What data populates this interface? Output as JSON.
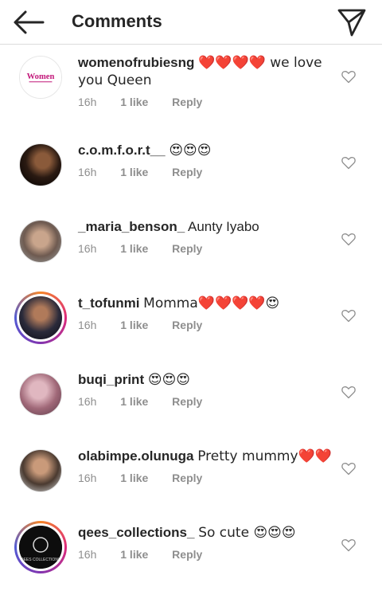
{
  "header": {
    "title": "Comments",
    "back_icon": "arrow-left-icon",
    "send_icon": "paper-plane-icon"
  },
  "comments": [
    {
      "username": "womenofrubiesng",
      "text": "❤️❤️❤️❤️ we love you Queen",
      "time": "16h",
      "likes": "1 like",
      "reply": "Reply",
      "avatar_text": "Women"
    },
    {
      "username": "c.o.m.f.o.r.t__",
      "text": "😍😍😍",
      "time": "16h",
      "likes": "1 like",
      "reply": "Reply"
    },
    {
      "username": "_maria_benson_",
      "text": "Aunty Iyabo",
      "time": "16h",
      "likes": "1 like",
      "reply": "Reply"
    },
    {
      "username": "t_tofunmi",
      "text": "Momma❤️❤️❤️❤️😍",
      "time": "16h",
      "likes": "1 like",
      "reply": "Reply"
    },
    {
      "username": "buqi_print",
      "text": "😍😍😍",
      "time": "16h",
      "likes": "1 like",
      "reply": "Reply"
    },
    {
      "username": "olabimpe.olunuga",
      "text": "Pretty mummy❤️❤️",
      "time": "16h",
      "likes": "1 like",
      "reply": "Reply"
    },
    {
      "username": "qees_collections_",
      "text": "So cute 😍😍😍",
      "time": "16h",
      "likes": "1 like",
      "reply": "Reply",
      "avatar_text": "QEES COLLECTIONS"
    }
  ],
  "colors": {
    "text": "#262626",
    "meta": "#8e8e8e",
    "border": "#dbdbdb",
    "heart_red": "#e0245e"
  }
}
